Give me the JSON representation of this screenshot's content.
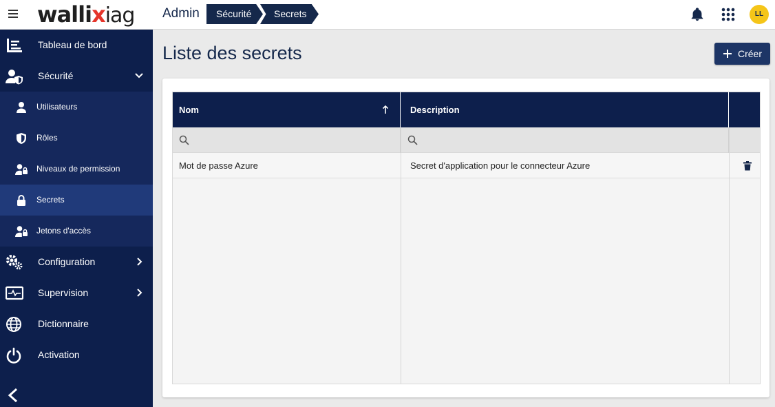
{
  "header": {
    "logo_main": "walli",
    "logo_x": "x",
    "logo_suffix": "iag",
    "section": "Admin",
    "breadcrumb": [
      "Sécurité",
      "Secrets"
    ],
    "avatar_initials": "LL"
  },
  "sidebar": {
    "items": [
      {
        "label": "Tableau de bord",
        "icon": "dashboard-icon"
      },
      {
        "label": "Sécurité",
        "icon": "user-shield-icon",
        "expanded": true
      },
      {
        "label": "Utilisateurs",
        "icon": "user-icon"
      },
      {
        "label": "Rôles",
        "icon": "shield-icon"
      },
      {
        "label": "Niveaux de permission",
        "icon": "user-lock-icon"
      },
      {
        "label": "Secrets",
        "icon": "lock-icon",
        "active": true
      },
      {
        "label": "Jetons d'accès",
        "icon": "user-key-icon"
      },
      {
        "label": "Configuration",
        "icon": "gears-icon"
      },
      {
        "label": "Supervision",
        "icon": "monitor-icon"
      },
      {
        "label": "Dictionnaire",
        "icon": "globe-icon"
      },
      {
        "label": "Activation",
        "icon": "power-icon"
      }
    ]
  },
  "main": {
    "title": "Liste des secrets",
    "create_label": "Créer",
    "table": {
      "columns": [
        "Nom",
        "Description",
        ""
      ],
      "rows": [
        {
          "nom": "Mot de passe Azure",
          "description": "Secret d'application pour le connecteur Azure"
        }
      ]
    }
  },
  "colors": {
    "navy": "#0d1f4c",
    "active": "#203a7a",
    "accent": "#e5342a",
    "avatar": "#f5c518"
  }
}
